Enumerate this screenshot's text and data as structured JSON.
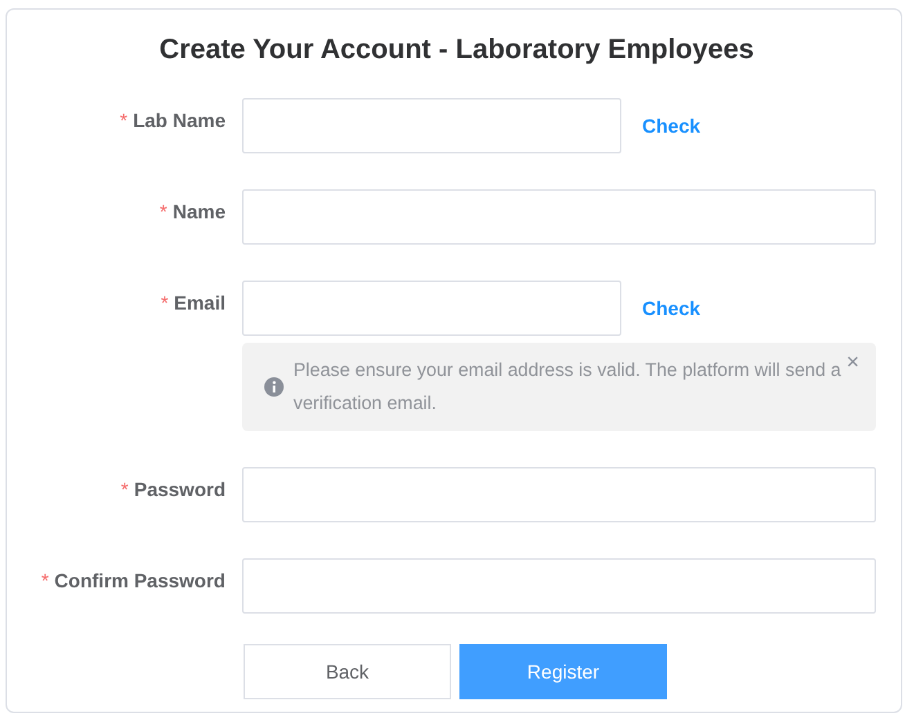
{
  "title": "Create Your Account - Laboratory Employees",
  "fields": [
    {
      "label": "Lab Name",
      "marker": "*",
      "kind": "short",
      "action": "Check"
    },
    {
      "label": "Name",
      "marker": "*",
      "kind": "full"
    },
    {
      "label": "Email",
      "marker": "*",
      "kind": "short",
      "action": "Check",
      "note": {
        "text": "Please ensure your email address is valid. The platform will send a verification email.",
        "close": "×"
      }
    },
    {
      "label": "Password",
      "marker": "*",
      "kind": "full"
    },
    {
      "label": "Confirm Password",
      "marker": "*",
      "kind": "full"
    }
  ],
  "buttons": [
    {
      "label": "Back",
      "kind": "secondary"
    },
    {
      "label": "Register",
      "kind": "primary"
    }
  ]
}
